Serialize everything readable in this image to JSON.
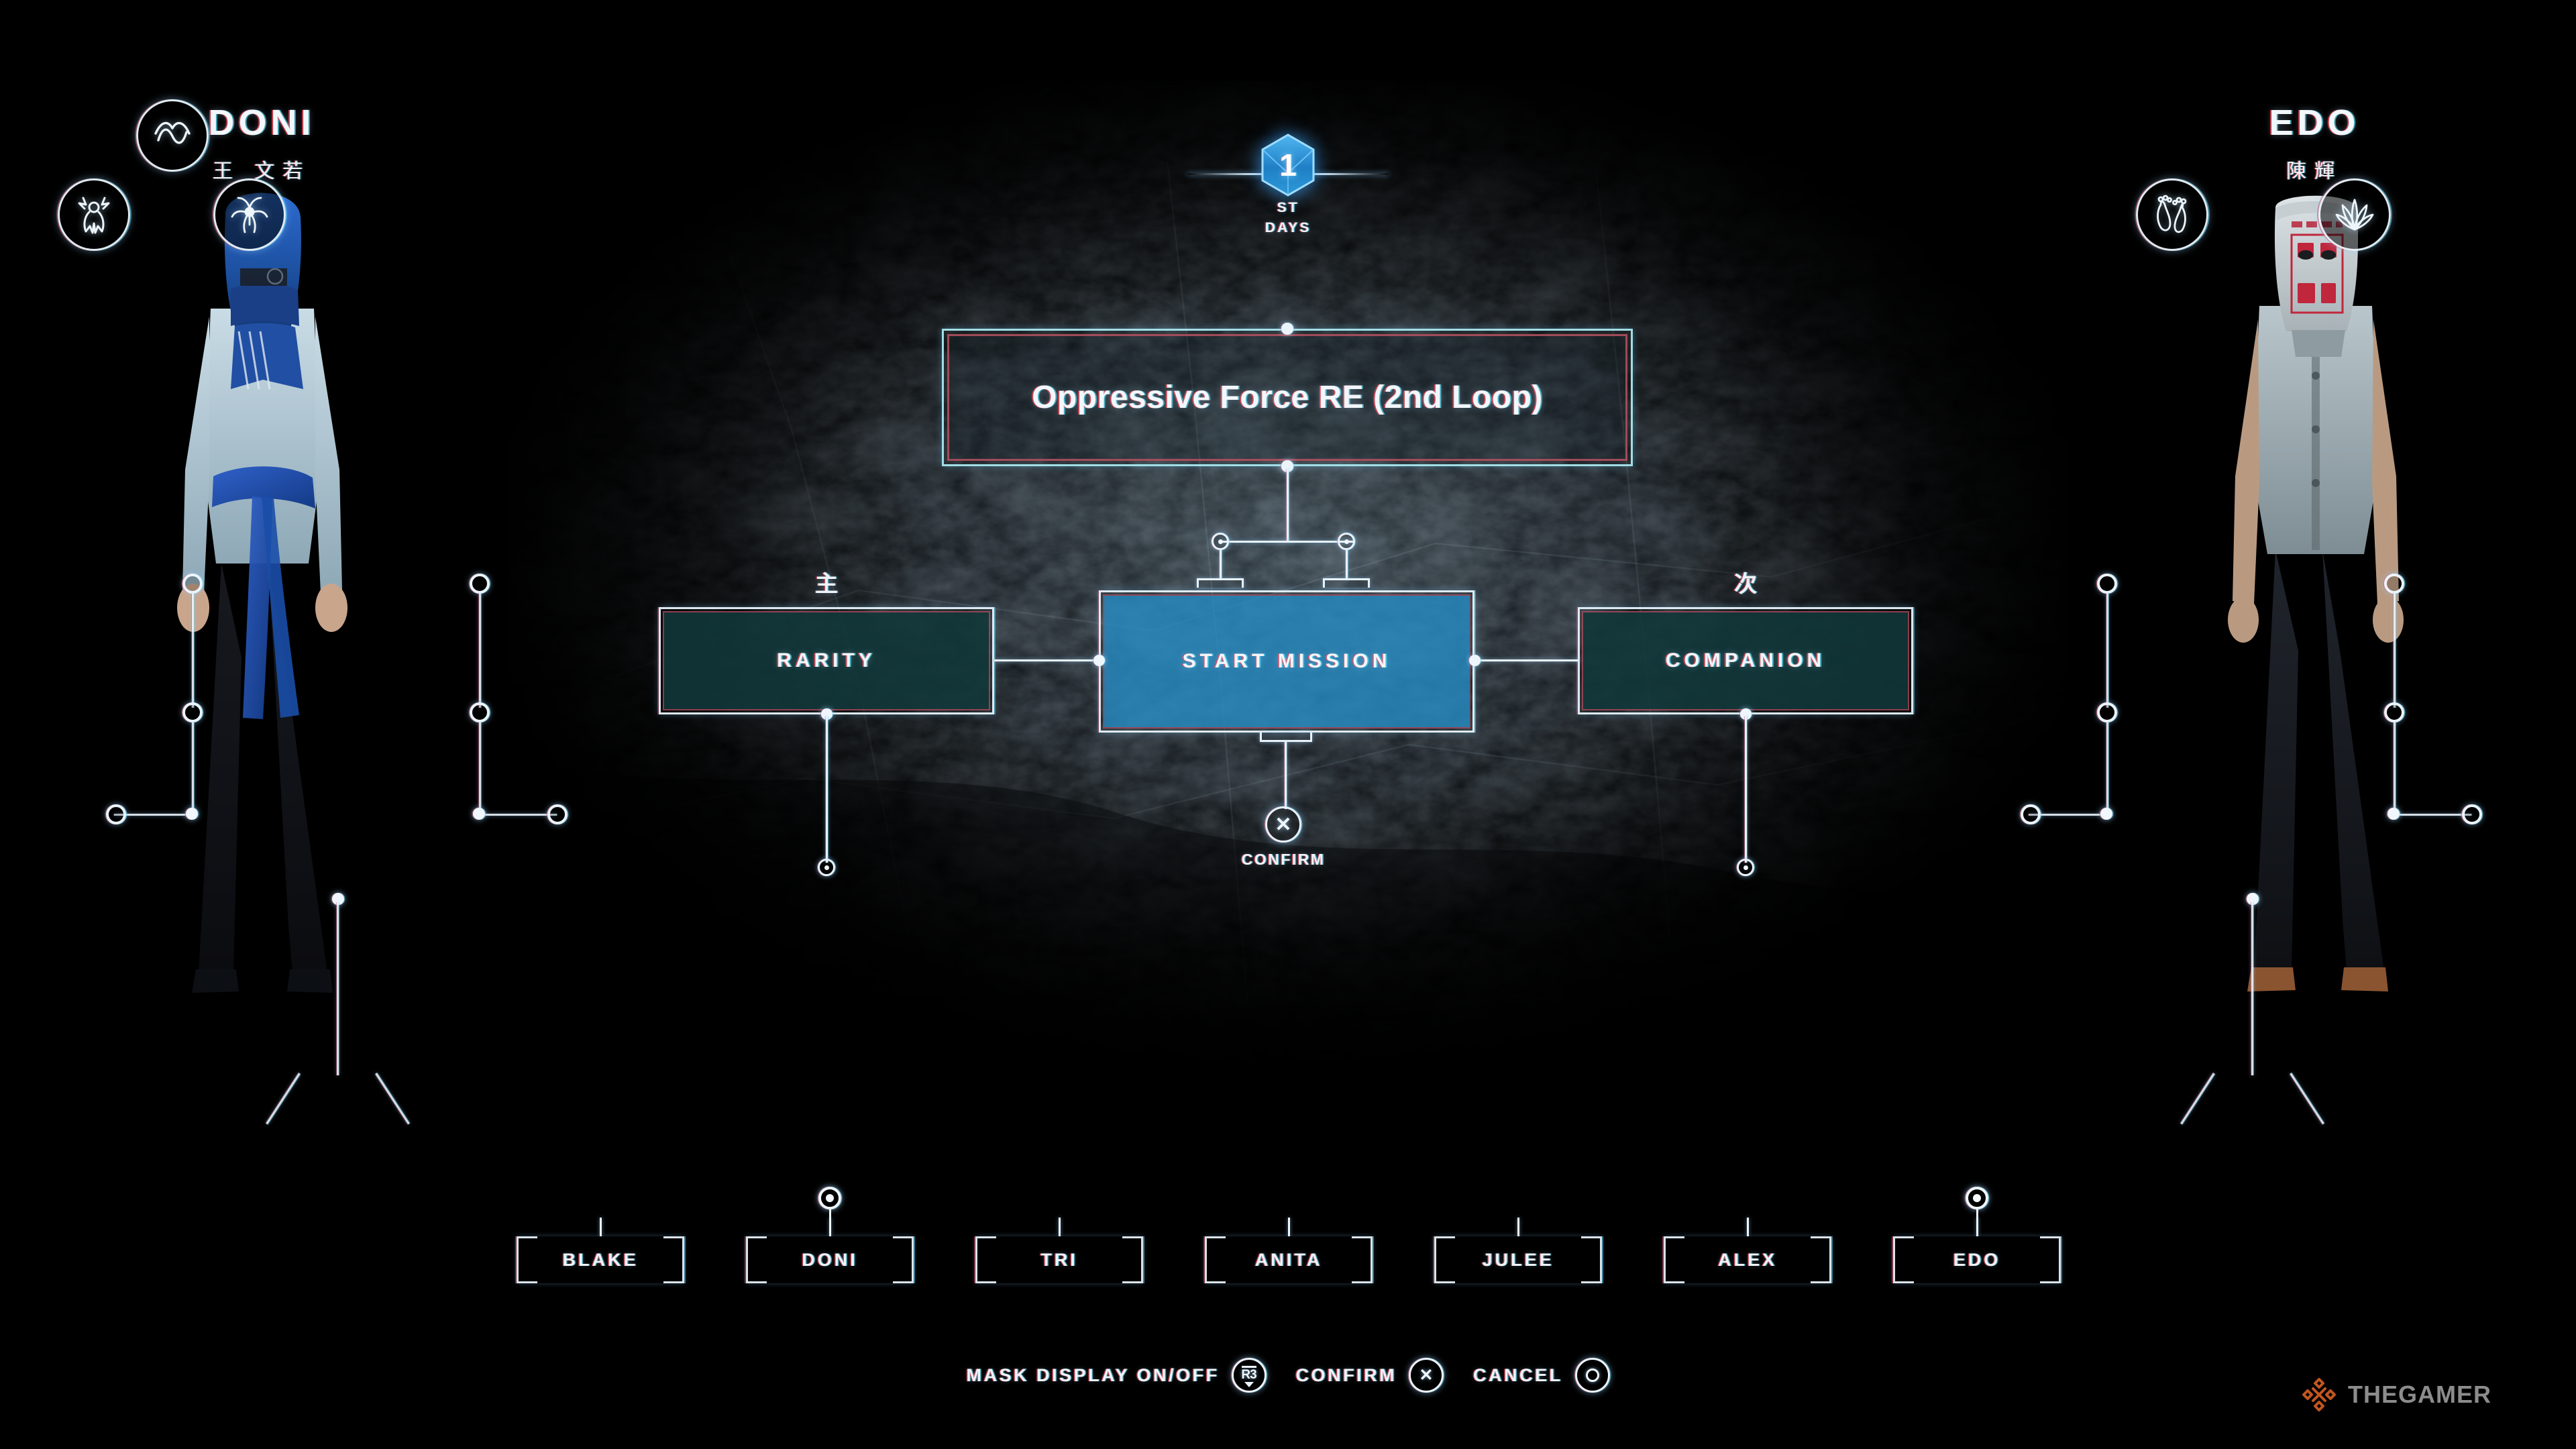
{
  "day_badge": {
    "number": "1",
    "ordinal_suffix": "ST",
    "unit": "DAYS"
  },
  "mission": {
    "title": "Oppressive Force RE (2nd Loop)"
  },
  "options": {
    "left": {
      "tag": "主",
      "label": "RARITY"
    },
    "center": {
      "label": "START MISSION"
    },
    "right": {
      "tag": "次",
      "label": "COMPANION"
    }
  },
  "confirm_node": {
    "label": "CONFIRM",
    "glyph": "✕"
  },
  "characters": {
    "left": {
      "name": "DONI",
      "name_cn": "王 文若",
      "skills": [
        "brainwave-icon",
        "spirit-burst-icon",
        "insect-icon"
      ]
    },
    "right": {
      "name": "EDO",
      "name_cn": "陳輝",
      "skills": [
        "footprints-icon",
        "feather-icon"
      ]
    }
  },
  "character_tabs": [
    {
      "label": "BLAKE",
      "selected": false
    },
    {
      "label": "DONI",
      "selected": true
    },
    {
      "label": "TRI",
      "selected": false
    },
    {
      "label": "ANITA",
      "selected": false
    },
    {
      "label": "JULEE",
      "selected": false
    },
    {
      "label": "ALEX",
      "selected": false
    },
    {
      "label": "EDO",
      "selected": true
    }
  ],
  "bottom_bar": [
    {
      "label": "MASK DISPLAY ON/OFF",
      "button": "R3",
      "icon": "r3-stick-icon"
    },
    {
      "label": "CONFIRM",
      "button": "✕",
      "icon": "cross-button-icon"
    },
    {
      "label": "CANCEL",
      "button": "○",
      "icon": "circle-button-icon"
    }
  ],
  "watermark": {
    "text": "THEGAMER",
    "logo_color": "#c2561f",
    "text_color": "#8c8c8c"
  },
  "colors": {
    "accent_cyan": "#a8e8f0",
    "accent_red": "#b4505f",
    "start_mission_fill": "#268cc4",
    "side_button_fill": "#11383a",
    "text": "#f2f7fb"
  }
}
